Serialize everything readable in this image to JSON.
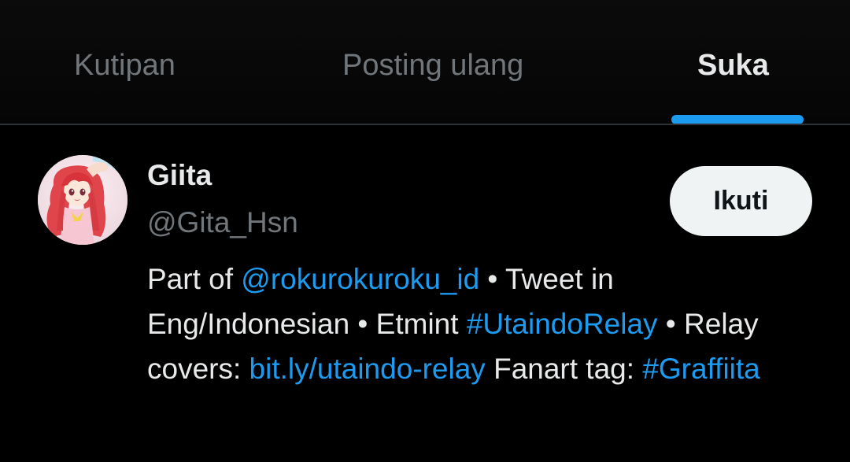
{
  "tabs": {
    "quotes": "Kutipan",
    "reposts": "Posting ulang",
    "likes": "Suka",
    "active": "likes"
  },
  "colors": {
    "accent": "#1d9bf0",
    "background": "#000000",
    "text_primary": "#e7e9ea",
    "text_secondary": "#71767b",
    "follow_button_bg": "#eff3f4"
  },
  "user": {
    "avatar_icon": "anime-girl-avatar",
    "display_name": "Giita",
    "handle": "@Gita_Hsn",
    "follow_label": "Ikuti",
    "bio": {
      "part1": "Part of ",
      "mention": "@rokurokuroku_id",
      "part2": " • Tweet in Eng/Indonesian • Etmint ",
      "hashtag1": "#UtaindoRelay",
      "part3": " • Relay covers: ",
      "link": "bit.ly/utaindo-relay",
      "part4": " Fanart tag: ",
      "hashtag2": "#Graffiita"
    }
  }
}
